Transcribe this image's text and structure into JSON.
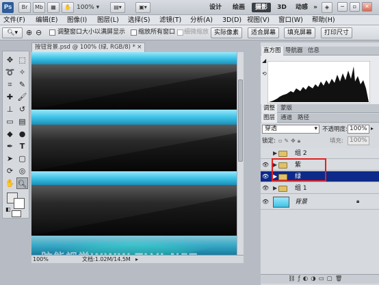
{
  "titlebar": {
    "logo": "Ps",
    "buttons": [
      "Br",
      "Mb"
    ],
    "zoom": "100%",
    "workspaces": [
      "设计",
      "绘画",
      "摄影",
      "3D",
      "动感"
    ],
    "active_workspace": "摄影",
    "overflow": "»",
    "window_controls": [
      "─",
      "▫",
      "✕"
    ]
  },
  "menubar": {
    "items": [
      "文件(F)",
      "编辑(E)",
      "图像(I)",
      "图层(L)",
      "选择(S)",
      "滤镜(T)",
      "分析(A)",
      "3D(D)",
      "视图(V)",
      "窗口(W)",
      "帮助(H)"
    ]
  },
  "options": {
    "checkbox_resize": "调整窗口大小以满屏显示",
    "checkbox_zoom_all": "缩放所有窗口",
    "checkbox_scrubby": "细微缩放",
    "btn_actual": "实际像素",
    "btn_fit": "适合屏幕",
    "btn_fill": "填充屏幕",
    "btn_print": "打印尺寸"
  },
  "document": {
    "tab_title": "按钮背景.psd @ 100% (绿, RGB/8) *",
    "close": "×",
    "status_zoom": "100%",
    "status_doc": "文档:1.02M/14.5M",
    "watermark": "脑能视觉WWW.TLVI.NET"
  },
  "panels": {
    "top_tabs": [
      "直方图",
      "导航器",
      "信息"
    ],
    "mid_tabs": [
      "调整",
      "蒙版"
    ],
    "layers_tabs": [
      "图层",
      "通道",
      "路径"
    ],
    "blend_mode": "穿透",
    "opacity_label": "不透明度:",
    "opacity_value": "100%",
    "lock_label": "锁定:",
    "fill_label": "填充:",
    "fill_value": "100%",
    "layers": [
      {
        "name": "组 2",
        "type": "group",
        "visible": false
      },
      {
        "name": "紫",
        "type": "group",
        "visible": true
      },
      {
        "name": "绿",
        "type": "group",
        "visible": true,
        "selected": true
      },
      {
        "name": "组 1",
        "type": "group",
        "visible": true
      },
      {
        "name": "背景",
        "type": "image",
        "visible": true,
        "locked": true
      }
    ]
  },
  "colors": {
    "accent_cyan": "#3ec3e6",
    "selection_blue": "#0d2a8a",
    "highlight_red": "#e02020",
    "glow_orange": "#e49a18",
    "glow_magenta": "#d13ad8",
    "glow_green": "#2fd43a"
  }
}
